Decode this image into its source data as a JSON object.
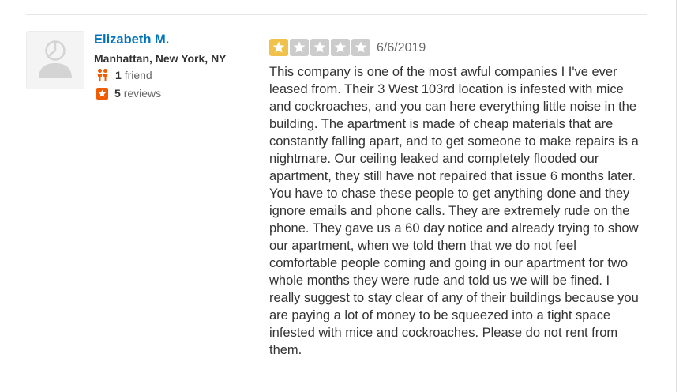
{
  "user": {
    "name": "Elizabeth M.",
    "location": "Manhattan, New York, NY",
    "friends_count": "1",
    "friends_label": "friend",
    "reviews_count": "5",
    "reviews_label": "reviews"
  },
  "review": {
    "rating": 1,
    "max_rating": 5,
    "date": "6/6/2019",
    "text": "This company is one of the most awful companies I I've ever leased from. Their 3 West 103rd location is infested with mice and cockroaches, and you can here everything little noise in the building. The apartment is made of cheap materials that are constantly falling apart, and to get someone to make repairs is a nightmare. Our ceiling leaked and completely flooded our apartment, they still have not repaired that issue 6 months later. You have to chase these people to get anything done and they ignore emails and phone calls. They are extremely rude on the phone. They gave us a 60 day notice and already trying to show our apartment, when we told them that we do not feel comfortable people coming and going in our apartment for two whole months they were rude and told us we will be fined. I really suggest to stay clear of any of their buildings because you are paying a lot of money to be squeezed into a tight space infested with mice and cockroaches. Please do not rent from them."
  },
  "colors": {
    "name_link": "#0073bb",
    "star_filled": "#f0c14b",
    "star_empty": "#cccccc",
    "friends_icon": "#f15c00",
    "reviews_icon": "#f15c00"
  },
  "icons": {
    "avatar": "user-silhouette-icon",
    "friends": "friends-icon",
    "reviews": "review-star-icon",
    "star": "star-icon"
  }
}
